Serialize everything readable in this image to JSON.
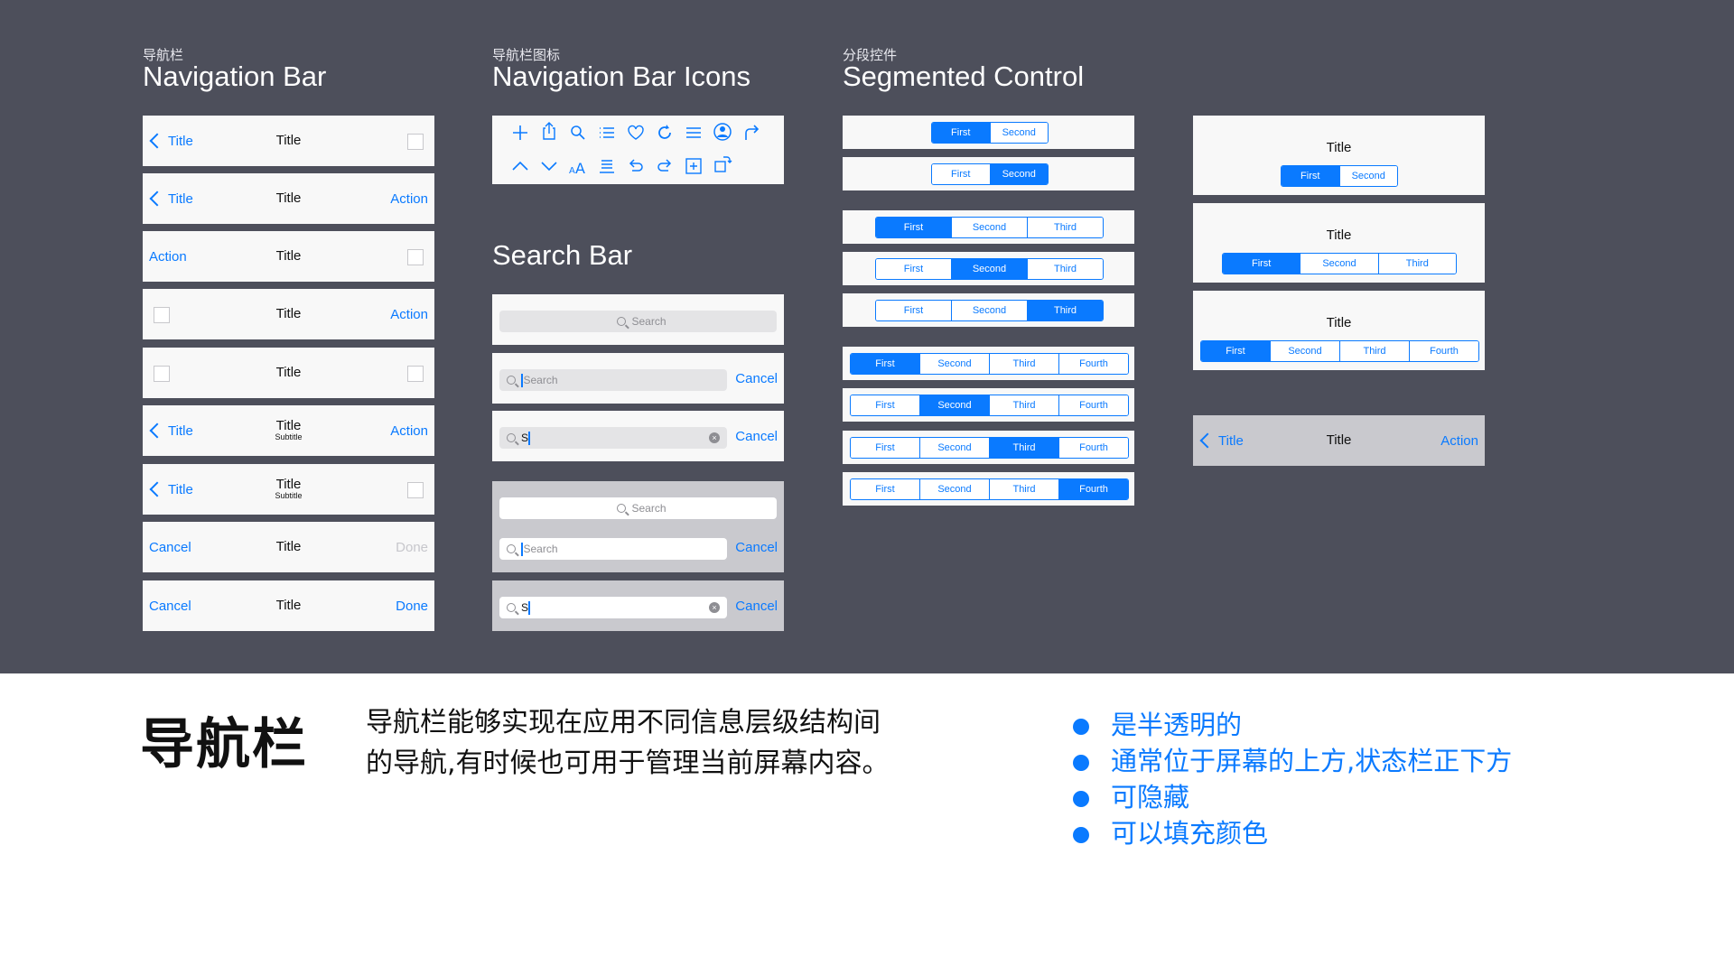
{
  "colors": {
    "accent": "#0a7aff",
    "banner": "#4d4f5b"
  },
  "sections": {
    "nav": {
      "cn": "导航栏",
      "en": "Navigation Bar"
    },
    "icons": {
      "cn": "导航栏图标",
      "en": "Navigation Bar Icons"
    },
    "seg": {
      "cn": "分段控件",
      "en": "Segmented Control"
    },
    "search": {
      "en": "Search Bar"
    }
  },
  "navbars": [
    {
      "left": "Title",
      "title": "Title",
      "subtitle": "",
      "right": ""
    },
    {
      "left": "Title",
      "title": "Title",
      "subtitle": "",
      "right": "Action"
    },
    {
      "left": "Action",
      "title": "Title",
      "subtitle": "",
      "right": ""
    },
    {
      "left": "",
      "title": "Title",
      "subtitle": "",
      "right": "Action"
    },
    {
      "left": "",
      "title": "Title",
      "subtitle": "",
      "right": ""
    },
    {
      "left": "Title",
      "title": "Title",
      "subtitle": "Subtitle",
      "right": "Action"
    },
    {
      "left": "Title",
      "title": "Title",
      "subtitle": "Subtitle",
      "right": ""
    },
    {
      "left": "Cancel",
      "title": "Title",
      "subtitle": "",
      "right": "Done"
    },
    {
      "left": "Cancel",
      "title": "Title",
      "subtitle": "",
      "right": "Done"
    }
  ],
  "icon_names": [
    "add-icon",
    "share-icon",
    "search-icon",
    "list-icon",
    "heart-icon",
    "refresh-icon",
    "menu-icon",
    "contact-icon",
    "reply-icon",
    "chevron-up-icon",
    "chevron-down-icon",
    "text-size-icon",
    "bookmarks-icon",
    "undo-icon",
    "redo-icon",
    "compose-icon",
    "rotate-icon"
  ],
  "search": {
    "placeholder": "Search",
    "typed": "S",
    "cancel": "Cancel"
  },
  "segmented": {
    "two": [
      "First",
      "Second"
    ],
    "three": [
      "First",
      "Second",
      "Third"
    ],
    "four": [
      "First",
      "Second",
      "Third",
      "Fourth"
    ],
    "title": "Title"
  },
  "bottom_nav": {
    "left": "Title",
    "title": "Title",
    "right": "Action"
  },
  "bottom": {
    "heading": "导航栏",
    "desc_line1": "导航栏能够实现在应用不同信息层级结构间",
    "desc_line2": "的导航,有时候也可用于管理当前屏幕内容。",
    "bullets": [
      "是半透明的",
      "通常位于屏幕的上方,状态栏正下方",
      "可隐藏",
      "可以填充颜色"
    ]
  }
}
